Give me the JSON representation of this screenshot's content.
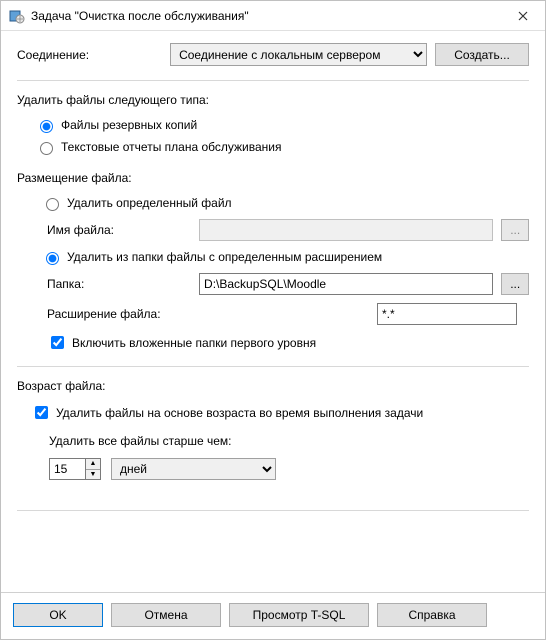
{
  "title": "Задача \"Очистка после обслуживания\"",
  "connection": {
    "label": "Соединение:",
    "value": "Соединение с локальным сервером",
    "create_btn": "Создать..."
  },
  "delete_files": {
    "group_label": "Удалить файлы следующего типа:",
    "opt_backup": "Файлы резервных копий",
    "opt_text_reports": "Текстовые отчеты плана обслуживания"
  },
  "file_location": {
    "group_label": "Размещение файла:",
    "opt_specific": "Удалить определенный файл",
    "filename_label": "Имя файла:",
    "filename_value": "",
    "opt_folder": "Удалить из папки файлы с определенным расширением",
    "folder_label": "Папка:",
    "folder_value": "D:\\BackupSQL\\Moodle",
    "ext_label": "Расширение файла:",
    "ext_value": "*.*",
    "include_sub": "Включить вложенные папки первого уровня",
    "browse": "..."
  },
  "file_age": {
    "group_label": "Возраст файла:",
    "delete_by_age": "Удалить файлы на основе возраста во время выполнения задачи",
    "older_than_label": "Удалить все файлы старше чем:",
    "value": "15",
    "unit": "дней"
  },
  "buttons": {
    "ok": "OK",
    "cancel": "Отмена",
    "tsql": "Просмотр T-SQL",
    "help": "Справка"
  }
}
